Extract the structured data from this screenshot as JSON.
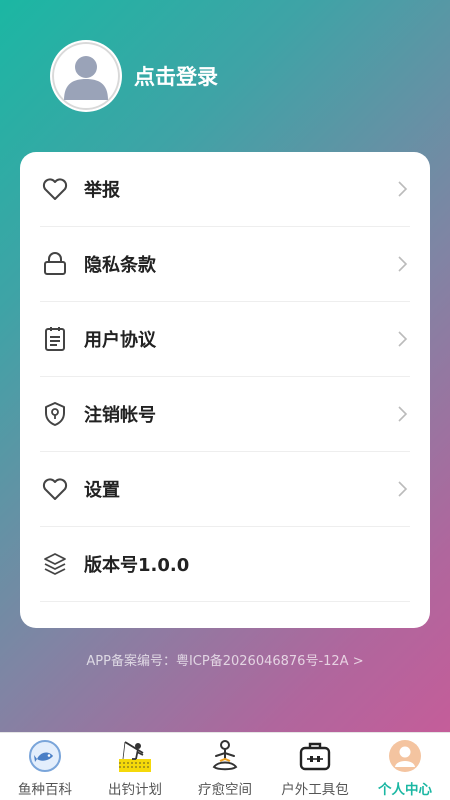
{
  "profile": {
    "login_label": "点击登录"
  },
  "menu": [
    {
      "label": "举报",
      "icon": "heart-icon"
    },
    {
      "label": "隐私条款",
      "icon": "lock-icon"
    },
    {
      "label": "用户协议",
      "icon": "clipboard-icon"
    },
    {
      "label": "注销帐号",
      "icon": "shield-icon"
    },
    {
      "label": "设置",
      "icon": "heart-icon"
    },
    {
      "label": "版本号1.0.0",
      "icon": "layers-icon"
    }
  ],
  "footer": {
    "icp_text": "APP备案编号：粤ICP备2026046876号-12A >"
  },
  "tabs": [
    {
      "label": "鱼种百科",
      "icon": "fish-icon"
    },
    {
      "label": "出钓计划",
      "icon": "fishing-icon"
    },
    {
      "label": "疗愈空间",
      "icon": "meditation-icon"
    },
    {
      "label": "户外工具包",
      "icon": "toolbox-icon"
    },
    {
      "label": "个人中心",
      "icon": "profile-icon",
      "active": true
    }
  ],
  "colors": {
    "accent": "#1bb7a3",
    "gradient_start": "#1bb7a3",
    "gradient_end": "#cc5a98"
  }
}
